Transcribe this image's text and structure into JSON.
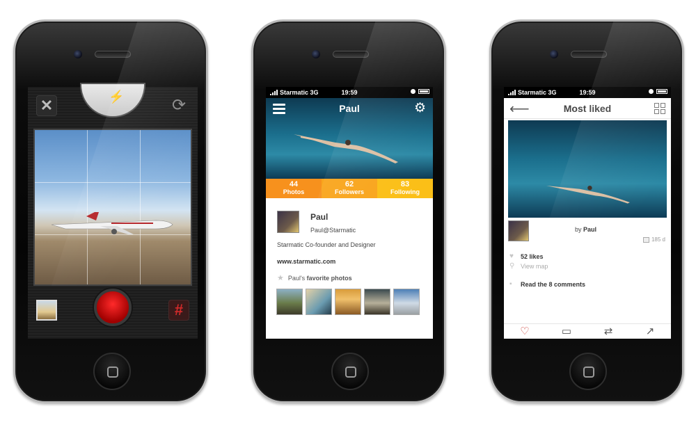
{
  "status_bar": {
    "carrier": "Starmatic",
    "network": "3G",
    "time": "19:59"
  },
  "camera": {
    "close_icon": "close-icon",
    "flash_icon": "lightning-icon",
    "flip_icon": "rotate-camera-icon",
    "grid_icon": "hash-grid-icon",
    "shutter_color": "#d00000"
  },
  "profile": {
    "title": "Paul",
    "stats": [
      {
        "count": "44",
        "label": "Photos"
      },
      {
        "count": "62",
        "label": "Followers"
      },
      {
        "count": "83",
        "label": "Following"
      }
    ],
    "name": "Paul",
    "handle": "Paul@Starmatic",
    "bio": "Starmatic Co-founder and Designer",
    "website": "www.starmatic.com",
    "favorites_prefix": "Paul's",
    "favorites_label": "favorite photos",
    "accent_colors": [
      "#f7911d",
      "#f9a51c",
      "#fbbf17"
    ]
  },
  "most_liked": {
    "title": "Most liked",
    "by_prefix": "by",
    "by_name": "Paul",
    "age": "185 d",
    "likes": "52 likes",
    "view_map": "View map",
    "comments": "Read the 8 comments",
    "actions": [
      "heart-icon",
      "comment-icon",
      "repost-icon",
      "share-icon"
    ]
  }
}
